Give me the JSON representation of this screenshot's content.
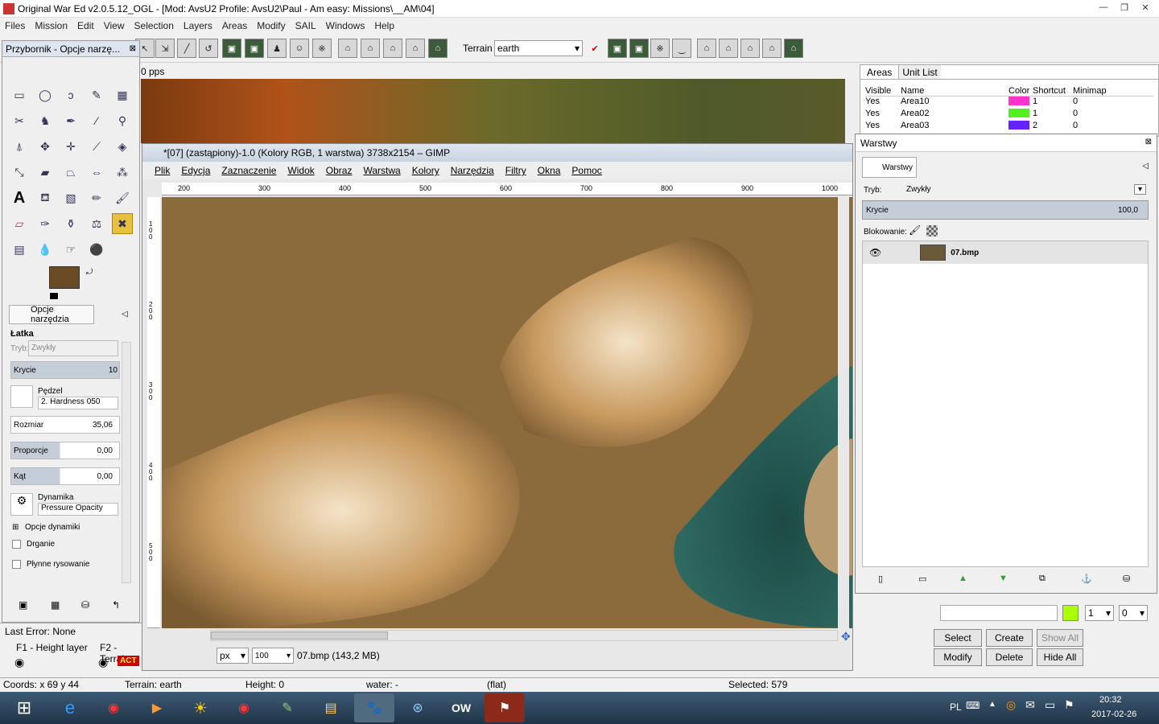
{
  "window_title": "Original War Ed v2.0.5.12_OGL - [Mod: AvsU2 Profile: AvsU2\\Paul - Am easy: Missions\\__AM\\04]",
  "menu": [
    "Files",
    "Mission",
    "Edit",
    "View",
    "Selection",
    "Layers",
    "Areas",
    "Modify",
    "SAIL",
    "Windows",
    "Help"
  ],
  "toolbar": {
    "terrain_label": "Terrain",
    "terrain_value": "earth"
  },
  "map": {
    "pps": "0 pps"
  },
  "toolbox": {
    "title": "Przybornik - Opcje narzę...",
    "tab": "Opcje narzędzia",
    "tool_name": "Łatka",
    "mode_label": "Tryb:",
    "mode_value": "Zwykły",
    "opacity_label": "Krycie",
    "opacity_value": "10",
    "brush_label": "Pędzel",
    "brush_value": "2. Hardness 050",
    "size_label": "Rozmiar",
    "size_value": "35,06",
    "aspect_label": "Proporcje",
    "aspect_value": "0,00",
    "angle_label": "Kąt",
    "angle_value": "0,00",
    "dynamics_label": "Dynamika",
    "dynamics_value": "Pressure Opacity",
    "dyn_options": "Opcje dynamiki",
    "jitter": "Drganie",
    "smooth": "Płynne rysowanie",
    "fg_color": "#6b4a26"
  },
  "gimp": {
    "title": "*[07] (zastąpiony)-1.0 (Kolory RGB, 1 warstwa) 3738x2154 – GIMP",
    "menu": [
      "Plik",
      "Edycja",
      "Zaznaczenie",
      "Widok",
      "Obraz",
      "Warstwa",
      "Kolory",
      "Narzędzia",
      "Filtry",
      "Okna",
      "Pomoc"
    ],
    "ruler_ticks": [
      "200",
      "300",
      "400",
      "500",
      "600",
      "700",
      "800",
      "900",
      "1000"
    ],
    "ruler_v_ticks": [
      "100",
      "200",
      "300",
      "400",
      "500"
    ],
    "unit": "px",
    "zoom": "100",
    "file_info": "07.bmp (143,2 MB)"
  },
  "areas": {
    "tabs": [
      "Areas",
      "Unit List"
    ],
    "columns": [
      "Visible",
      "Name",
      "Color",
      "Shortcut",
      "Minimap"
    ],
    "rows": [
      {
        "visible": "Yes",
        "name": "Area10",
        "color": "#ff33cc",
        "shortcut": "1",
        "minimap": "0"
      },
      {
        "visible": "Yes",
        "name": "Area02",
        "color": "#55ee22",
        "shortcut": "1",
        "minimap": "0"
      },
      {
        "visible": "Yes",
        "name": "Area03",
        "color": "#6622ff",
        "shortcut": "2",
        "minimap": "0"
      }
    ]
  },
  "layers": {
    "title": "Warstwy",
    "tab": "Warstwy",
    "mode_label": "Tryb:",
    "mode_value": "Zwykły",
    "opacity_label": "Krycie",
    "opacity_value": "100,0",
    "lock_label": "Blokowanie:",
    "layer_name": "07.bmp"
  },
  "area_controls": {
    "color": "#aaff00",
    "sel1": "1",
    "sel2": "0",
    "buttons": [
      "Select",
      "Create",
      "Show All",
      "Modify",
      "Delete",
      "Hide All"
    ]
  },
  "left_bottom": {
    "last_error": "Last Error: None",
    "f1": "F1 - Height layer",
    "f2": "F2 - Terrain",
    "act": "ACT"
  },
  "status": {
    "coords": "Coords: x 69 y 44",
    "terrain": "Terrain: earth",
    "height": "Height: 0",
    "water": "water: -",
    "flat": "(flat)",
    "selected": "Selected: 579"
  },
  "taskbar": {
    "lang": "PL",
    "time": "20:32",
    "date": "2017-02-26"
  }
}
